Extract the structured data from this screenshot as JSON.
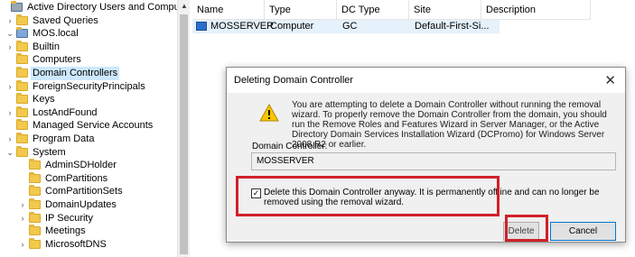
{
  "tree": {
    "items": [
      {
        "label": "Active Directory Users and Computers [MC",
        "chevron": "",
        "icon": "aduc-icon",
        "indent": 0
      },
      {
        "label": "Saved Queries",
        "chevron": "›",
        "icon": "folder-icon",
        "indent": 1
      },
      {
        "label": "MOS.local",
        "chevron": "⌄",
        "icon": "domain-icon",
        "indent": 1
      },
      {
        "label": "Builtin",
        "chevron": "›",
        "icon": "folder-icon",
        "indent": 2
      },
      {
        "label": "Computers",
        "chevron": "",
        "icon": "folder-icon",
        "indent": 2
      },
      {
        "label": "Domain Controllers",
        "chevron": "",
        "icon": "folder-icon",
        "indent": 2,
        "selected": true
      },
      {
        "label": "ForeignSecurityPrincipals",
        "chevron": "›",
        "icon": "folder-icon",
        "indent": 2
      },
      {
        "label": "Keys",
        "chevron": "",
        "icon": "folder-icon",
        "indent": 2
      },
      {
        "label": "LostAndFound",
        "chevron": "›",
        "icon": "folder-icon",
        "indent": 2
      },
      {
        "label": "Managed Service Accounts",
        "chevron": "",
        "icon": "folder-icon",
        "indent": 2
      },
      {
        "label": "Program Data",
        "chevron": "›",
        "icon": "folder-icon",
        "indent": 2
      },
      {
        "label": "System",
        "chevron": "⌄",
        "icon": "folder-icon",
        "indent": 2
      },
      {
        "label": "AdminSDHolder",
        "chevron": "",
        "icon": "folder-icon",
        "indent": 3
      },
      {
        "label": "ComPartitions",
        "chevron": "",
        "icon": "folder-icon",
        "indent": 3
      },
      {
        "label": "ComPartitionSets",
        "chevron": "",
        "icon": "folder-icon",
        "indent": 3
      },
      {
        "label": "DomainUpdates",
        "chevron": "›",
        "icon": "folder-icon",
        "indent": 3
      },
      {
        "label": "IP Security",
        "chevron": "›",
        "icon": "folder-icon",
        "indent": 3
      },
      {
        "label": "Meetings",
        "chevron": "",
        "icon": "folder-icon",
        "indent": 3
      },
      {
        "label": "MicrosoftDNS",
        "chevron": "›",
        "icon": "folder-icon",
        "indent": 3
      }
    ]
  },
  "list": {
    "columns": [
      "Name",
      "Type",
      "DC Type",
      "Site",
      "Description"
    ],
    "rows": [
      {
        "name": "MOSSERVER",
        "type": "Computer",
        "dc_type": "GC",
        "site": "Default-First-Si...",
        "description": ""
      }
    ]
  },
  "dialog": {
    "title": "Deleting Domain Controller",
    "message": "You are attempting to delete a Domain Controller without running the removal wizard. To properly remove the Domain Controller from the domain, you should run the Remove Roles and Features Wizard in Server Manager, or the Active Directory Domain Services Installation Wizard (DCPromo) for Windows Server 2008 R2 or earlier.",
    "dc_label": "Domain Controller:",
    "dc_value": "MOSSERVER",
    "checkbox_label": "Delete this Domain Controller anyway. It is permanently offline and can no longer be removed using the removal wizard.",
    "checkbox_checked": true,
    "delete_label": "Delete",
    "cancel_label": "Cancel",
    "close_glyph": "✕"
  },
  "colors": {
    "highlight": "#d0202a",
    "selection": "#cde8ff",
    "row_selected": "#e5f1fb"
  }
}
